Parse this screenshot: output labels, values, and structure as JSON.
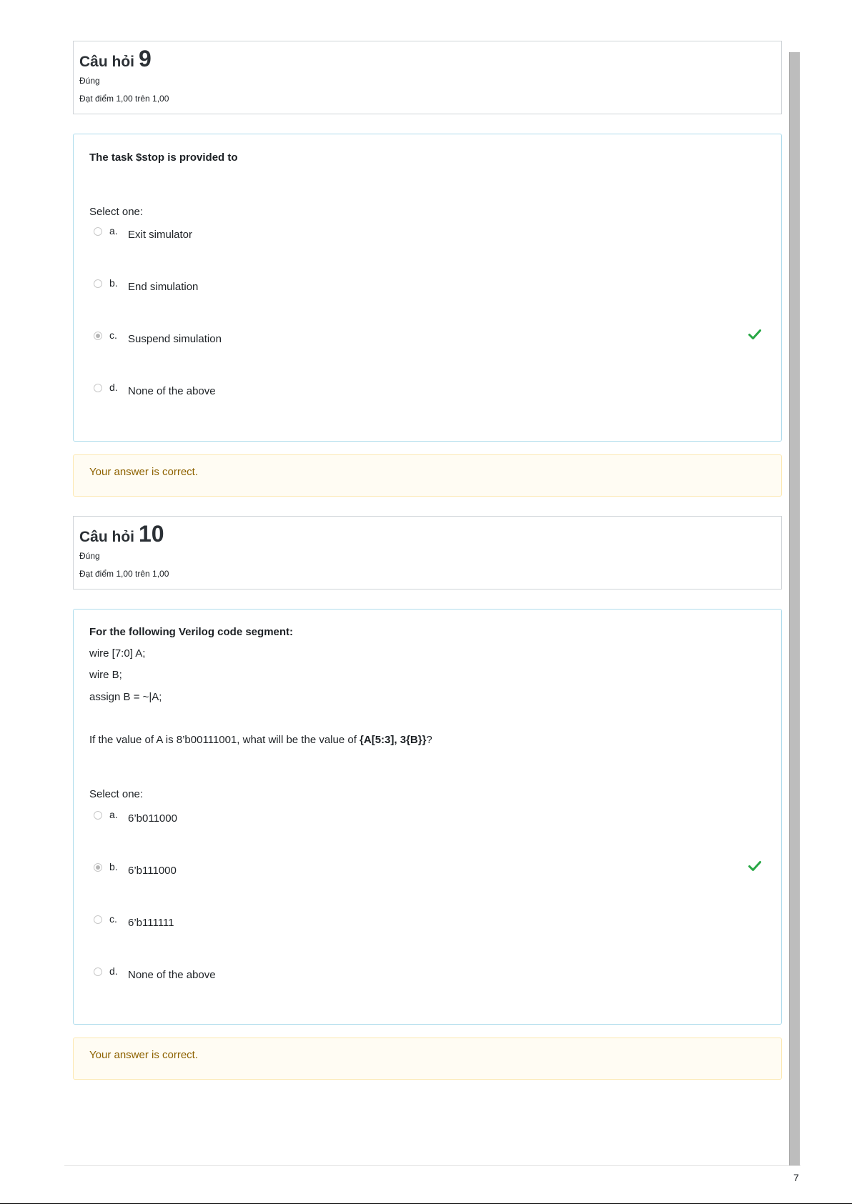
{
  "questions": [
    {
      "header_prefix": "Câu hỏi",
      "number": "9",
      "state": "Đúng",
      "grade": "Đạt điểm 1,00 trên 1,00",
      "text_lines": [
        "The task $stop is provided to"
      ],
      "prompt": "Select one:",
      "answers": [
        {
          "letter": "a.",
          "text": "Exit simulator",
          "selected": false,
          "correct_mark": false
        },
        {
          "letter": "b.",
          "text": "End simulation",
          "selected": false,
          "correct_mark": false
        },
        {
          "letter": "c.",
          "text": "Suspend simulation",
          "selected": true,
          "correct_mark": true
        },
        {
          "letter": "d.",
          "text": "None of the above",
          "selected": false,
          "correct_mark": false
        }
      ],
      "feedback": "Your answer is correct."
    },
    {
      "header_prefix": "Câu hỏi",
      "number": "10",
      "state": "Đúng",
      "grade": "Đạt điểm 1,00 trên 1,00",
      "text_lines": [
        "For the following Verilog code segment:",
        "wire [7:0] A;",
        "wire B;",
        "assign B = ~|A;"
      ],
      "question_line": {
        "before": "If the value of A is 8’b00111001, what will be the value of ",
        "bold": "{A[5:3], 3{B}}",
        "after": "?"
      },
      "prompt": "Select one:",
      "answers": [
        {
          "letter": "a.",
          "text": "6’b011000",
          "selected": false,
          "correct_mark": false
        },
        {
          "letter": "b.",
          "text": "6’b111000",
          "selected": true,
          "correct_mark": true
        },
        {
          "letter": "c.",
          "text": "6’b111111",
          "selected": false,
          "correct_mark": false
        },
        {
          "letter": "d.",
          "text": "None of the above",
          "selected": false,
          "correct_mark": false
        }
      ],
      "feedback": "Your answer is correct."
    }
  ],
  "page_number": "7",
  "colors": {
    "correct_check": "#28a745",
    "feedback_text": "#8e6200",
    "formulation_border": "#aedcec",
    "feedback_background": "#fffcf3"
  },
  "icons": {
    "correct": "check-icon",
    "radio": "radio-icon"
  }
}
